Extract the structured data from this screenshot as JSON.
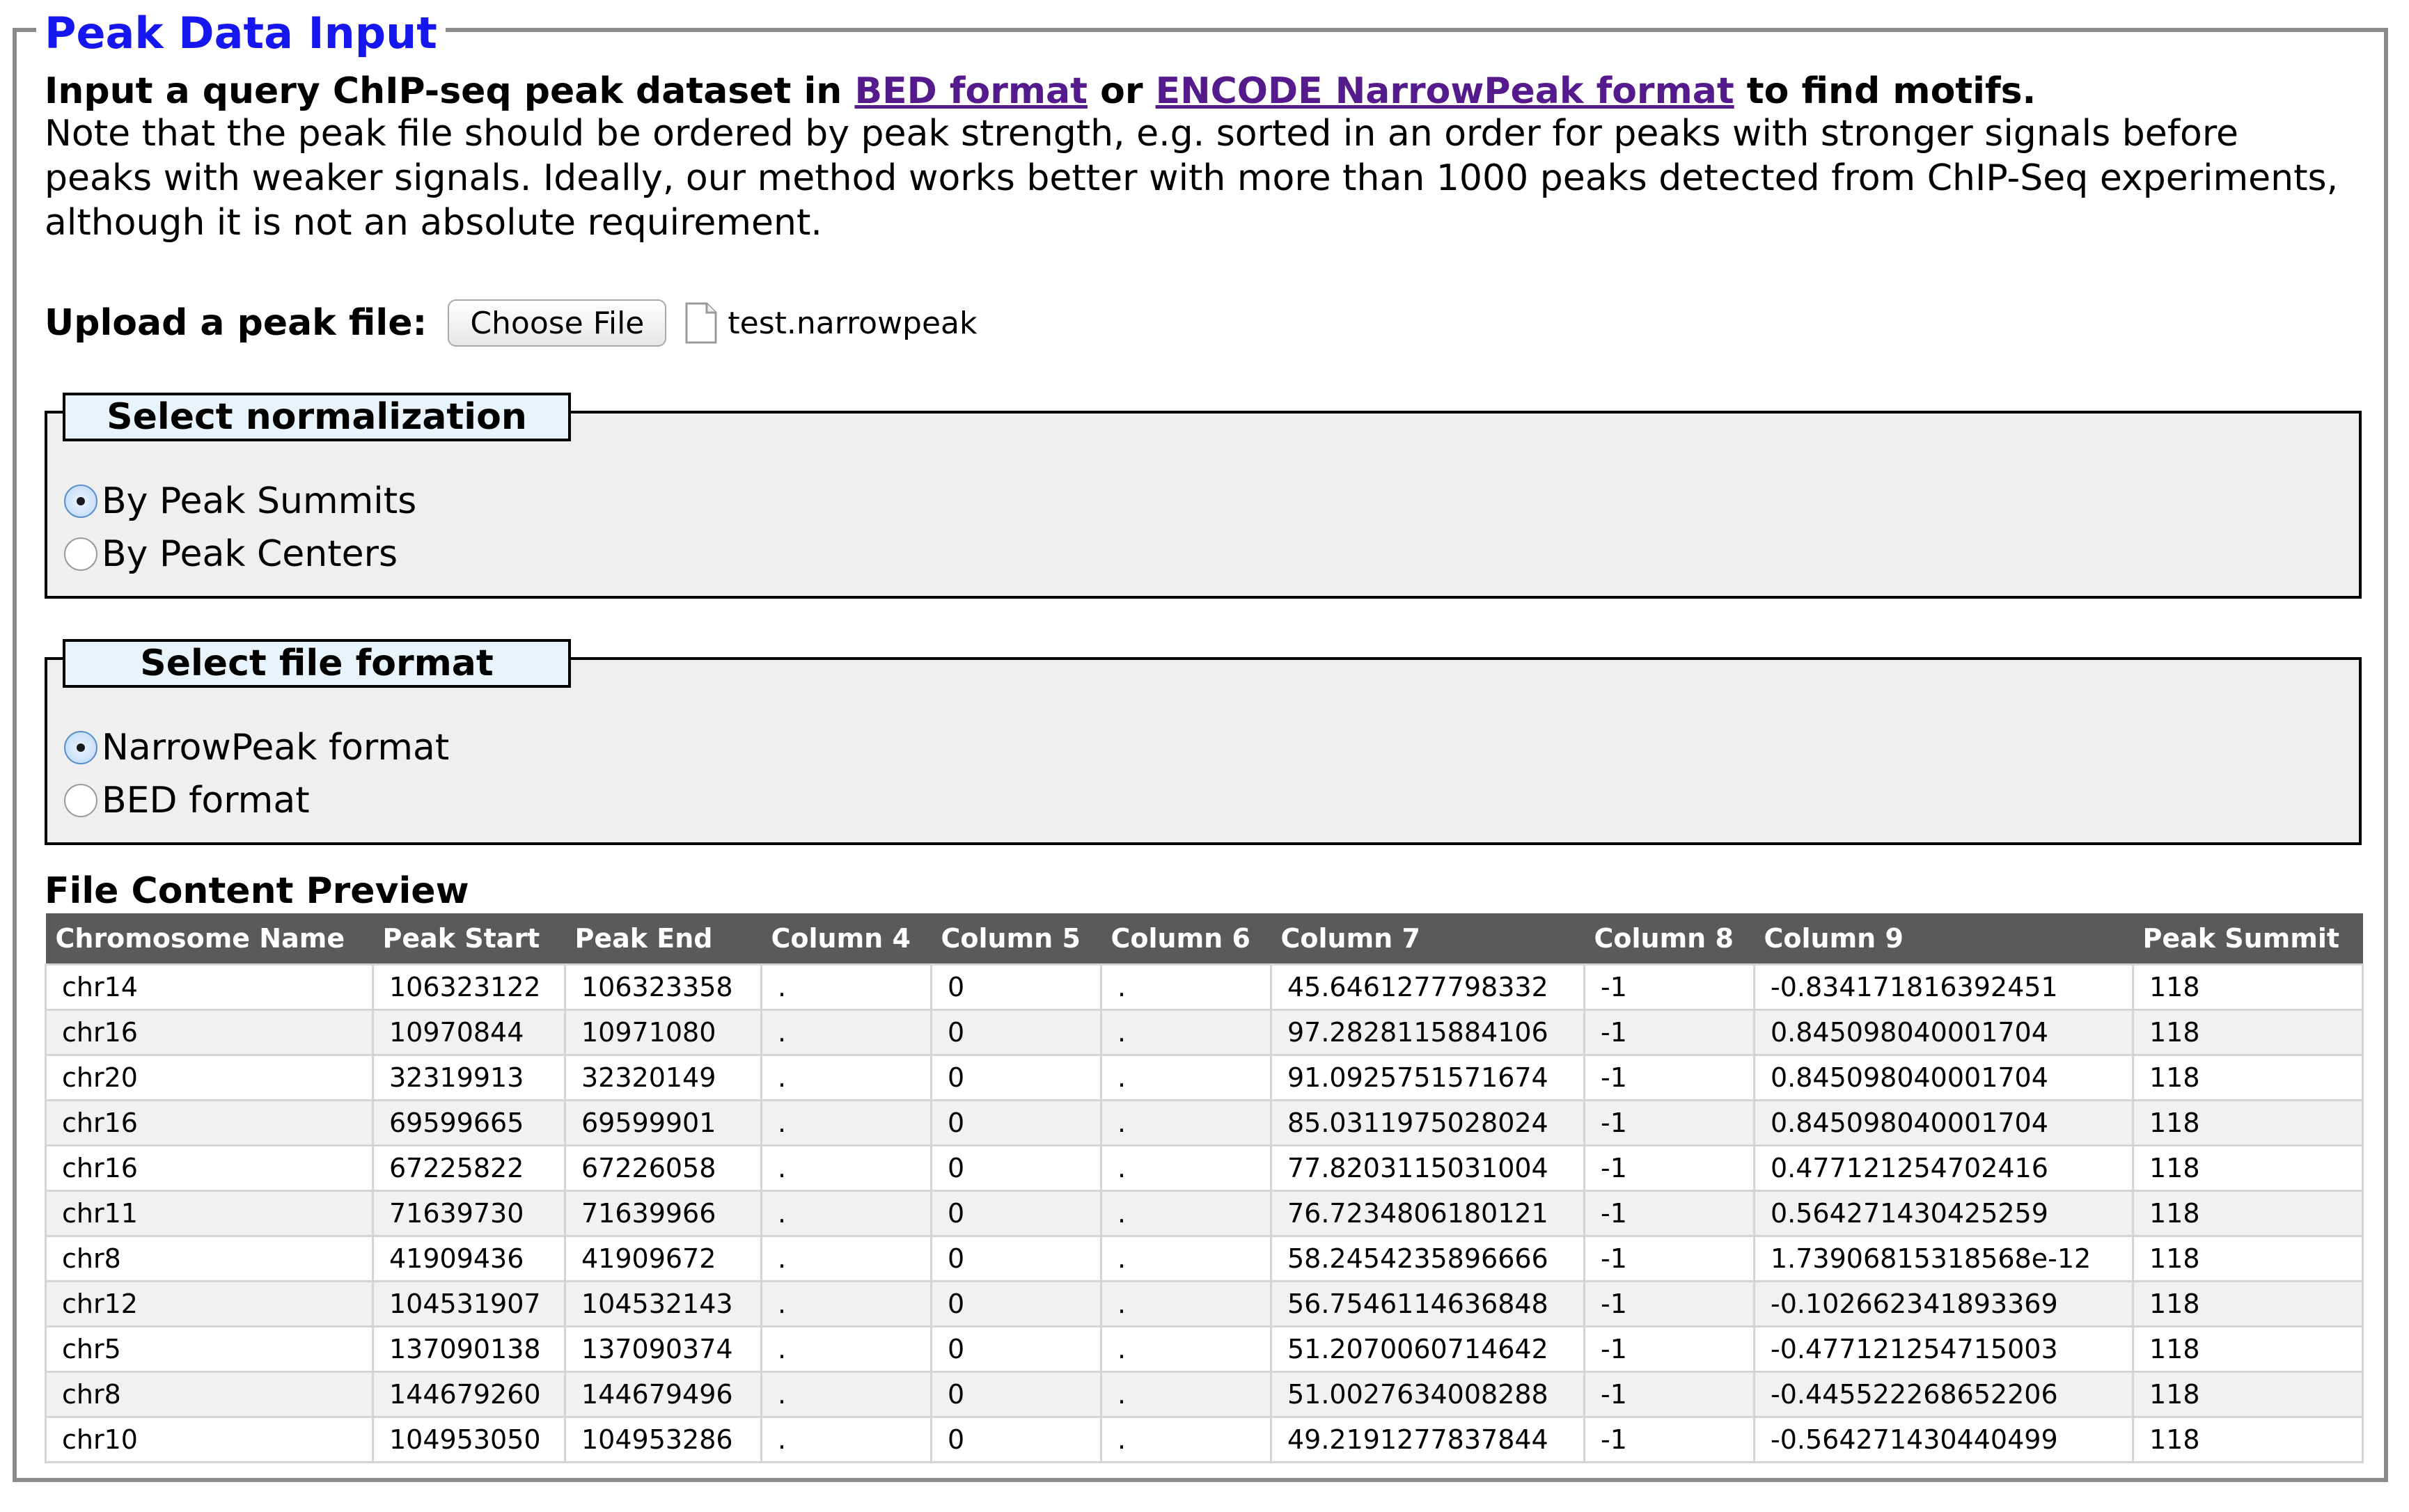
{
  "panel": {
    "title": "Peak Data Input"
  },
  "intro": {
    "prefix": "Input a query ChIP-seq peak dataset in ",
    "link1": "BED format",
    "middle": " or ",
    "link2": "ENCODE NarrowPeak format",
    "suffix": " to find motifs.",
    "note": "Note that the peak file should be ordered by peak strength, e.g. sorted in an order for peaks with stronger signals before peaks with weaker signals. Ideally, our method works better with more than 1000 peaks detected from ChIP-Seq experiments, although it is not an absolute requirement."
  },
  "upload": {
    "label": "Upload a peak file:",
    "button": "Choose File",
    "file_name": "test.narrowpeak",
    "icon": "file-icon"
  },
  "normalization": {
    "title": "Select normalization",
    "options": [
      {
        "label": "By Peak Summits",
        "checked": true
      },
      {
        "label": "By Peak Centers",
        "checked": false
      }
    ]
  },
  "file_format": {
    "title": "Select file format",
    "options": [
      {
        "label": "NarrowPeak format",
        "checked": true
      },
      {
        "label": "BED format",
        "checked": false
      }
    ]
  },
  "preview": {
    "title": "File Content Preview",
    "columns": [
      "Chromosome Name",
      "Peak Start",
      "Peak End",
      "Column 4",
      "Column 5",
      "Column 6",
      "Column 7",
      "Column 8",
      "Column 9",
      "Peak Summit"
    ],
    "rows": [
      [
        "chr14",
        "106323122",
        "106323358",
        ".",
        "0",
        ".",
        "45.6461277798332",
        "-1",
        "-0.834171816392451",
        "118"
      ],
      [
        "chr16",
        "10970844",
        "10971080",
        ".",
        "0",
        ".",
        "97.2828115884106",
        "-1",
        "0.845098040001704",
        "118"
      ],
      [
        "chr20",
        "32319913",
        "32320149",
        ".",
        "0",
        ".",
        "91.0925751571674",
        "-1",
        "0.845098040001704",
        "118"
      ],
      [
        "chr16",
        "69599665",
        "69599901",
        ".",
        "0",
        ".",
        "85.0311975028024",
        "-1",
        "0.845098040001704",
        "118"
      ],
      [
        "chr16",
        "67225822",
        "67226058",
        ".",
        "0",
        ".",
        "77.8203115031004",
        "-1",
        "0.477121254702416",
        "118"
      ],
      [
        "chr11",
        "71639730",
        "71639966",
        ".",
        "0",
        ".",
        "76.7234806180121",
        "-1",
        "0.564271430425259",
        "118"
      ],
      [
        "chr8",
        "41909436",
        "41909672",
        ".",
        "0",
        ".",
        "58.2454235896666",
        "-1",
        "1.73906815318568e-12",
        "118"
      ],
      [
        "chr12",
        "104531907",
        "104532143",
        ".",
        "0",
        ".",
        "56.7546114636848",
        "-1",
        "-0.102662341893369",
        "118"
      ],
      [
        "chr5",
        "137090138",
        "137090374",
        ".",
        "0",
        ".",
        "51.2070060714642",
        "-1",
        "-0.477121254715003",
        "118"
      ],
      [
        "chr8",
        "144679260",
        "144679496",
        ".",
        "0",
        ".",
        "51.0027634008288",
        "-1",
        "-0.445522268652206",
        "118"
      ],
      [
        "chr10",
        "104953050",
        "104953286",
        ".",
        "0",
        ".",
        "49.2191277837844",
        "-1",
        "-0.564271430440499",
        "118"
      ]
    ]
  },
  "colors": {
    "legend_text": "#1616ee",
    "link": "#551a8b",
    "header_bg": "#5a5a5a",
    "subfieldset_bg": "#efefef",
    "sublegend_bg": "#e9f3fc"
  }
}
